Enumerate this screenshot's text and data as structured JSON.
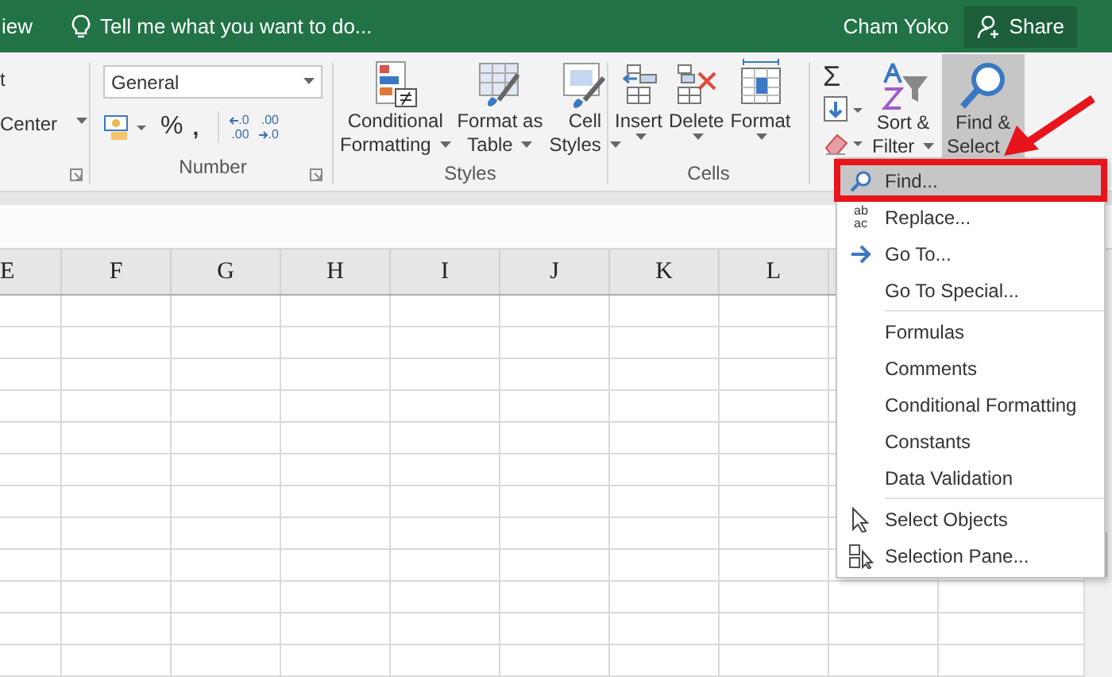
{
  "title_bar": {
    "tab_partial": "iew",
    "tell_me": "Tell me what you want to do...",
    "user": "Cham Yoko",
    "share": "Share"
  },
  "ribbon": {
    "alignment_partial": {
      "wrap": "t",
      "merge": "Center"
    },
    "number": {
      "format": "General",
      "percent": "%",
      "comma": ",",
      "decimals": [
        {
          "kind": "increase",
          "top": ".0",
          "bottom": ".00"
        },
        {
          "kind": "decrease",
          "top": ".00",
          "bottom": ".0"
        }
      ],
      "label": "Number"
    },
    "styles": {
      "buttons": [
        {
          "kind": "conditional",
          "line1": "Conditional",
          "line2": "Formatting"
        },
        {
          "kind": "table",
          "line1": "Format as",
          "line2": "Table"
        },
        {
          "kind": "cell",
          "line1": "Cell",
          "line2": "Styles"
        }
      ],
      "label": "Styles"
    },
    "cells": {
      "buttons": [
        {
          "kind": "insert",
          "label": "Insert"
        },
        {
          "kind": "delete",
          "label": "Delete"
        },
        {
          "kind": "format",
          "label": "Format"
        }
      ],
      "label": "Cells"
    },
    "editing": {
      "sum": "Σ",
      "buttons": [
        {
          "kind": "sort",
          "line1": "Sort &",
          "line2": "Filter",
          "selected": false
        },
        {
          "kind": "find",
          "line1": "Find &",
          "line2": "Select",
          "selected": true
        }
      ]
    }
  },
  "sheet": {
    "columns": [
      "E",
      "F",
      "G",
      "H",
      "I",
      "J",
      "K",
      "L"
    ]
  },
  "menu": {
    "sections": [
      [
        {
          "label": "Find...",
          "kind": "find",
          "selected": true,
          "annotated": true
        },
        {
          "label": "Replace...",
          "kind": "replace",
          "icon_text": [
            "ab",
            "ac"
          ],
          "selected": false,
          "annotated": false
        },
        {
          "label": "Go To...",
          "kind": "goto",
          "selected": false,
          "annotated": false
        },
        {
          "label": "Go To Special...",
          "kind": "plain",
          "selected": false,
          "annotated": false
        }
      ],
      [
        {
          "label": "Formulas",
          "kind": "plain",
          "selected": false,
          "annotated": false
        },
        {
          "label": "Comments",
          "kind": "plain",
          "selected": false,
          "annotated": false
        },
        {
          "label": "Conditional Formatting",
          "kind": "plain",
          "selected": false,
          "annotated": false
        },
        {
          "label": "Constants",
          "kind": "plain",
          "selected": false,
          "annotated": false
        },
        {
          "label": "Data Validation",
          "kind": "plain",
          "selected": false,
          "annotated": false
        }
      ],
      [
        {
          "label": "Select Objects",
          "kind": "select_objects",
          "selected": false,
          "annotated": false
        },
        {
          "label": "Selection Pane...",
          "kind": "selection_pane",
          "selected": false,
          "annotated": false
        }
      ]
    ]
  }
}
